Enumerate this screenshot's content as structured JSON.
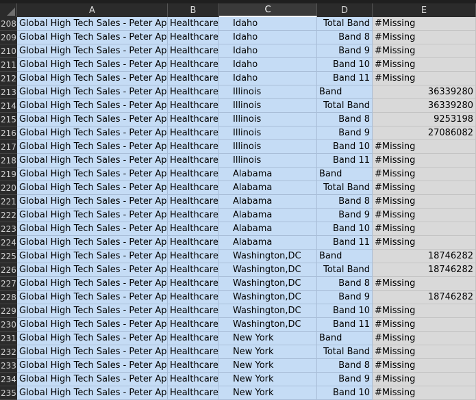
{
  "columns": [
    "A",
    "B",
    "C",
    "D",
    "E"
  ],
  "rows": [
    {
      "n": "208",
      "a": "Global High Tech Sales - Peter Apt",
      "b": "Healthcare",
      "c": "Idaho",
      "d": "Total Band",
      "d_align": "r",
      "e": "#Missing",
      "e_align": "l"
    },
    {
      "n": "209",
      "a": "Global High Tech Sales - Peter Apt",
      "b": "Healthcare",
      "c": "Idaho",
      "d": "Band 8",
      "d_align": "r",
      "e": "#Missing",
      "e_align": "l"
    },
    {
      "n": "210",
      "a": "Global High Tech Sales - Peter Apt",
      "b": "Healthcare",
      "c": "Idaho",
      "d": "Band 9",
      "d_align": "r",
      "e": "#Missing",
      "e_align": "l"
    },
    {
      "n": "211",
      "a": "Global High Tech Sales - Peter Apt",
      "b": "Healthcare",
      "c": "Idaho",
      "d": "Band 10",
      "d_align": "r",
      "e": "#Missing",
      "e_align": "l"
    },
    {
      "n": "212",
      "a": "Global High Tech Sales - Peter Apt",
      "b": "Healthcare",
      "c": "Idaho",
      "d": "Band 11",
      "d_align": "r",
      "e": "#Missing",
      "e_align": "l"
    },
    {
      "n": "213",
      "a": "Global High Tech Sales - Peter Apt",
      "b": "Healthcare",
      "c": "Illinois",
      "d": "Band",
      "d_align": "l",
      "e": "36339280",
      "e_align": "r"
    },
    {
      "n": "214",
      "a": "Global High Tech Sales - Peter Apt",
      "b": "Healthcare",
      "c": "Illinois",
      "d": "Total Band",
      "d_align": "r",
      "e": "36339280",
      "e_align": "r"
    },
    {
      "n": "215",
      "a": "Global High Tech Sales - Peter Apt",
      "b": "Healthcare",
      "c": "Illinois",
      "d": "Band 8",
      "d_align": "r",
      "e": "9253198",
      "e_align": "r"
    },
    {
      "n": "216",
      "a": "Global High Tech Sales - Peter Apt",
      "b": "Healthcare",
      "c": "Illinois",
      "d": "Band 9",
      "d_align": "r",
      "e": "27086082",
      "e_align": "r"
    },
    {
      "n": "217",
      "a": "Global High Tech Sales - Peter Apt",
      "b": "Healthcare",
      "c": "Illinois",
      "d": "Band 10",
      "d_align": "r",
      "e": "#Missing",
      "e_align": "l"
    },
    {
      "n": "218",
      "a": "Global High Tech Sales - Peter Apt",
      "b": "Healthcare",
      "c": "Illinois",
      "d": "Band 11",
      "d_align": "r",
      "e": "#Missing",
      "e_align": "l"
    },
    {
      "n": "219",
      "a": "Global High Tech Sales - Peter Apt",
      "b": "Healthcare",
      "c": "Alabama",
      "d": "Band",
      "d_align": "l",
      "e": "#Missing",
      "e_align": "l"
    },
    {
      "n": "220",
      "a": "Global High Tech Sales - Peter Apt",
      "b": "Healthcare",
      "c": "Alabama",
      "d": "Total Band",
      "d_align": "r",
      "e": "#Missing",
      "e_align": "l"
    },
    {
      "n": "221",
      "a": "Global High Tech Sales - Peter Apt",
      "b": "Healthcare",
      "c": "Alabama",
      "d": "Band 8",
      "d_align": "r",
      "e": "#Missing",
      "e_align": "l"
    },
    {
      "n": "222",
      "a": "Global High Tech Sales - Peter Apt",
      "b": "Healthcare",
      "c": "Alabama",
      "d": "Band 9",
      "d_align": "r",
      "e": "#Missing",
      "e_align": "l"
    },
    {
      "n": "223",
      "a": "Global High Tech Sales - Peter Apt",
      "b": "Healthcare",
      "c": "Alabama",
      "d": "Band 10",
      "d_align": "r",
      "e": "#Missing",
      "e_align": "l"
    },
    {
      "n": "224",
      "a": "Global High Tech Sales - Peter Apt",
      "b": "Healthcare",
      "c": "Alabama",
      "d": "Band 11",
      "d_align": "r",
      "e": "#Missing",
      "e_align": "l"
    },
    {
      "n": "225",
      "a": "Global High Tech Sales - Peter Apt",
      "b": "Healthcare",
      "c": "Washington,DC",
      "d": "Band",
      "d_align": "l",
      "e": "18746282",
      "e_align": "r"
    },
    {
      "n": "226",
      "a": "Global High Tech Sales - Peter Apt",
      "b": "Healthcare",
      "c": "Washington,DC",
      "d": "Total Band",
      "d_align": "r",
      "e": "18746282",
      "e_align": "r"
    },
    {
      "n": "227",
      "a": "Global High Tech Sales - Peter Apt",
      "b": "Healthcare",
      "c": "Washington,DC",
      "d": "Band 8",
      "d_align": "r",
      "e": "#Missing",
      "e_align": "l"
    },
    {
      "n": "228",
      "a": "Global High Tech Sales - Peter Apt",
      "b": "Healthcare",
      "c": "Washington,DC",
      "d": "Band 9",
      "d_align": "r",
      "e": "18746282",
      "e_align": "r"
    },
    {
      "n": "229",
      "a": "Global High Tech Sales - Peter Apt",
      "b": "Healthcare",
      "c": "Washington,DC",
      "d": "Band 10",
      "d_align": "r",
      "e": "#Missing",
      "e_align": "l"
    },
    {
      "n": "230",
      "a": "Global High Tech Sales - Peter Apt",
      "b": "Healthcare",
      "c": "Washington,DC",
      "d": "Band 11",
      "d_align": "r",
      "e": "#Missing",
      "e_align": "l"
    },
    {
      "n": "231",
      "a": "Global High Tech Sales - Peter Apt",
      "b": "Healthcare",
      "c": "New York",
      "d": "Band",
      "d_align": "l",
      "e": "#Missing",
      "e_align": "l"
    },
    {
      "n": "232",
      "a": "Global High Tech Sales - Peter Apt",
      "b": "Healthcare",
      "c": "New York",
      "d": "Total Band",
      "d_align": "r",
      "e": "#Missing",
      "e_align": "l"
    },
    {
      "n": "233",
      "a": "Global High Tech Sales - Peter Apt",
      "b": "Healthcare",
      "c": "New York",
      "d": "Band 8",
      "d_align": "r",
      "e": "#Missing",
      "e_align": "l"
    },
    {
      "n": "234",
      "a": "Global High Tech Sales - Peter Apt",
      "b": "Healthcare",
      "c": "New York",
      "d": "Band 9",
      "d_align": "r",
      "e": "#Missing",
      "e_align": "l"
    },
    {
      "n": "235",
      "a": "Global High Tech Sales - Peter Apt",
      "b": "Healthcare",
      "c": "New York",
      "d": "Band 10",
      "d_align": "r",
      "e": "#Missing",
      "e_align": "l"
    }
  ],
  "colors": {
    "selection_fill": "#c5dcf5",
    "unselected_fill": "#d9d9d9",
    "header_bg": "#2b2b2b"
  }
}
